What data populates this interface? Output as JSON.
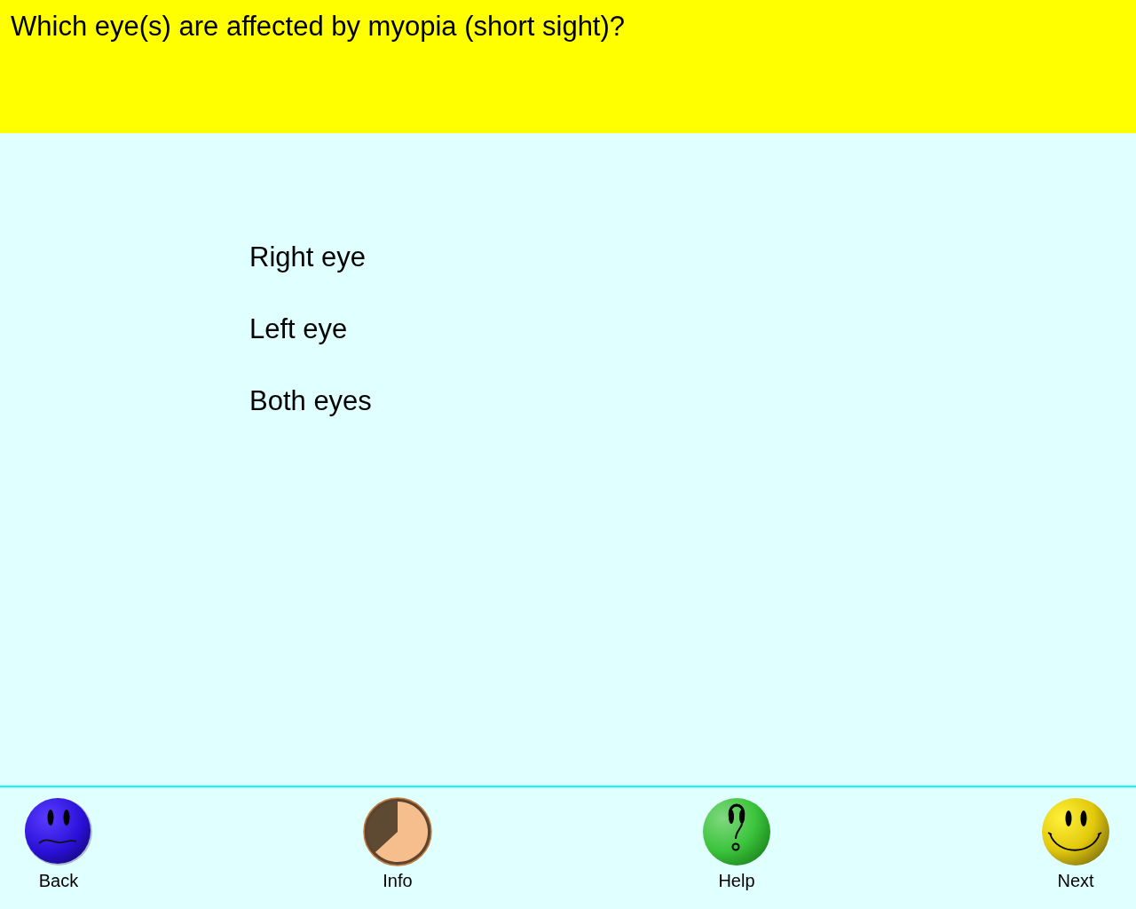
{
  "question": {
    "text": "Which eye(s) are affected by myopia (short sight)?"
  },
  "answers": [
    "Right eye",
    "Left eye",
    "Both eyes"
  ],
  "nav_buttons": [
    {
      "kind": "back",
      "label": "Back"
    },
    {
      "kind": "info",
      "label": "Info"
    },
    {
      "kind": "help",
      "label": "Help"
    },
    {
      "kind": "next",
      "label": "Next"
    }
  ]
}
